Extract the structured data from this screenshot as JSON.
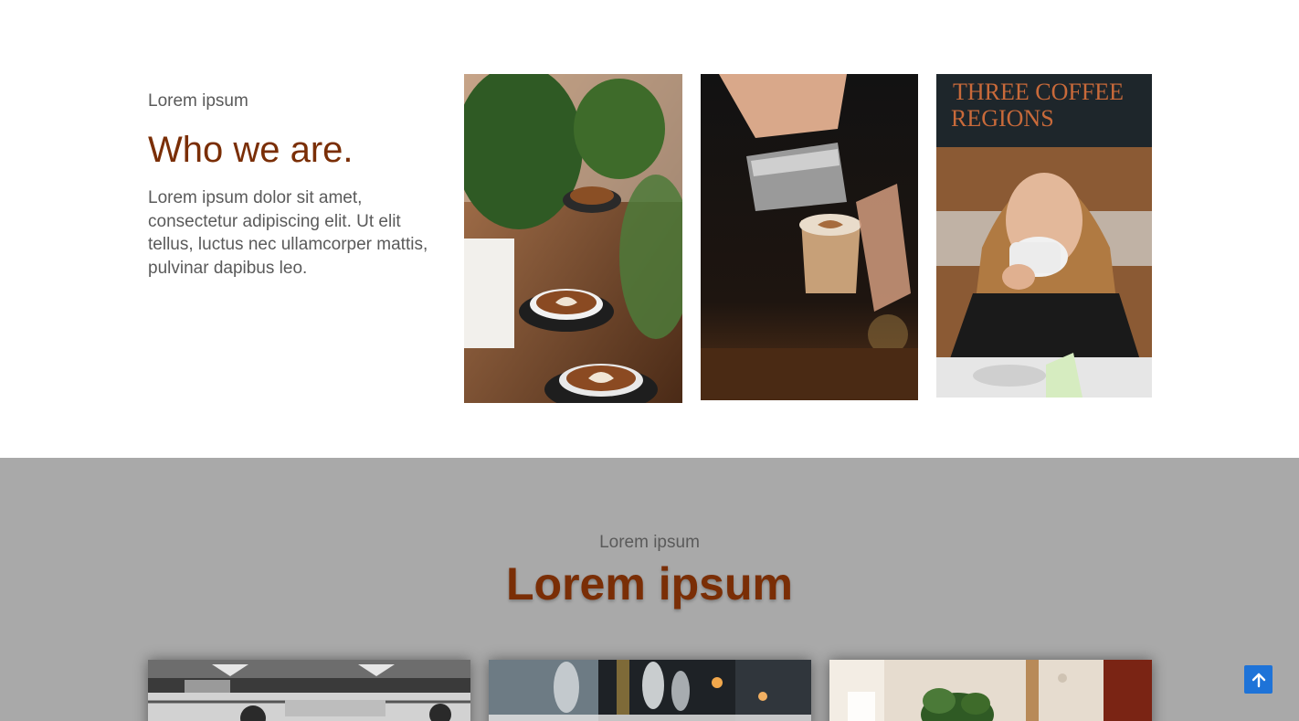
{
  "about": {
    "eyebrow": "Lorem ipsum",
    "title": "Who we are.",
    "body": "Lorem ipsum dolor sit amet, consectetur adipiscing elit. Ut elit tellus, luctus nec ullamcorper mattis, pulvinar dapibus leo.",
    "photos": [
      {
        "name": "latte-cups-with-plants-photo"
      },
      {
        "name": "barista-pouring-latte-photo"
      },
      {
        "name": "woman-drinking-coffee-photo",
        "sign_text": [
          "THREE COFFEE",
          "REGIONS"
        ]
      }
    ]
  },
  "section2": {
    "eyebrow": "Lorem ipsum",
    "title": "Lorem ipsum",
    "cards": [
      {
        "name": "cafe-interior-photo"
      },
      {
        "name": "restaurant-glasses-photo"
      },
      {
        "name": "plant-on-table-photo"
      }
    ]
  },
  "scroll_to_top": {
    "icon": "arrow-up-icon"
  },
  "colors": {
    "accent": "#7a2e06",
    "text": "#5a5a5a",
    "section_bg": "#a9a9a9",
    "button": "#1e73d8"
  }
}
